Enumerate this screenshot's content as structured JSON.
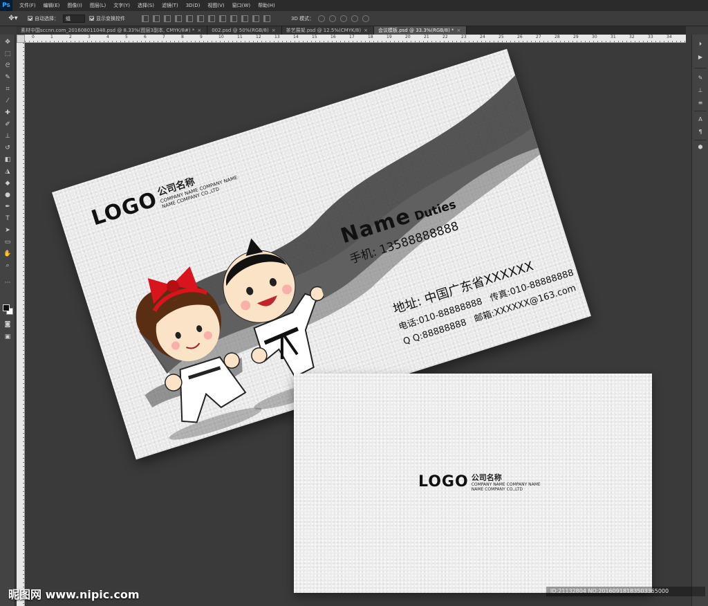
{
  "app": {
    "logo": "Ps",
    "menu": [
      "文件(F)",
      "编辑(E)",
      "图像(I)",
      "图层(L)",
      "文字(Y)",
      "选择(S)",
      "滤镜(T)",
      "3D(D)",
      "视图(V)",
      "窗口(W)",
      "帮助(H)"
    ]
  },
  "options": {
    "auto_select_label": "自动选择：",
    "auto_select_value": "组",
    "show_transform_label": "显示变换控件",
    "mode3d_label": "3D 模式："
  },
  "tabs": [
    {
      "label": "素材中国sccnn.com_201608011048.psd @ 8.33%(图层3副本, CMYK/8#) *",
      "close": "×"
    },
    {
      "label": "002.psd @ 50%(RGB/8)",
      "close": "×"
    },
    {
      "label": "茶艺展架.psd @ 12.5%(CMYK/8)",
      "close": "×"
    },
    {
      "label": "会议模板.psd @ 33.3%(RGB/8) *",
      "close": "×"
    }
  ],
  "ruler": {
    "h_ticks": [
      "0",
      "1",
      "2",
      "3",
      "4",
      "5",
      "6",
      "7",
      "8",
      "9",
      "10",
      "11",
      "12",
      "13",
      "14",
      "15",
      "16",
      "17",
      "18",
      "19",
      "20",
      "21",
      "22",
      "23",
      "24",
      "25",
      "26",
      "27",
      "28",
      "29",
      "30",
      "31",
      "32",
      "33",
      "34"
    ]
  },
  "card_front": {
    "logo": "LOGO",
    "company_cn": "公司名称",
    "company_en_1": "COMPANY NAME COMPANY NAME",
    "company_en_2": "NAME COMPANY CO.,LTD",
    "name": "Name",
    "duty": "Duties",
    "mobile_label": "手机:",
    "mobile": "13588888888",
    "address": "地址:  中国广东省XXXXXX",
    "tel": "电话:010-88888888",
    "fax": "传真:010-88888888",
    "qq": "Q Q:88888888",
    "email": "邮箱:XXXXXX@163.com"
  },
  "card_back": {
    "logo": "LOGO",
    "company_cn": "公司名称",
    "company_en_1": "COMPANY NAME COMPANY NAME",
    "company_en_2": "NAME COMPANY CO.,LTD"
  },
  "footer": {
    "watermark": "昵图网 www.nipic.com",
    "image_id": "ID:21132804 NO:20160918183503365000"
  },
  "colors": {
    "bow_red": "#d9141c",
    "ink": "#2a2a2a"
  }
}
